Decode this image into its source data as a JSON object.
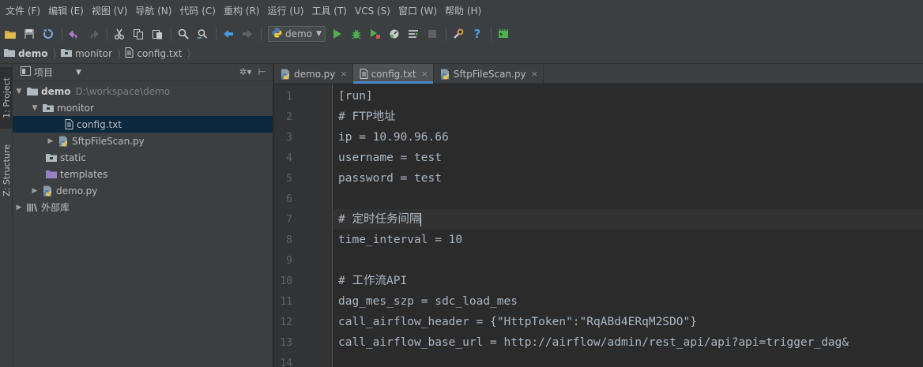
{
  "menubar": {
    "items": [
      "文件 (F)",
      "编辑 (E)",
      "视图 (V)",
      "导航 (N)",
      "代码 (C)",
      "重构 (R)",
      "运行 (U)",
      "工具 (T)",
      "VCS (S)",
      "窗口 (W)",
      "帮助 (H)"
    ]
  },
  "toolbar": {
    "run_config": "demo"
  },
  "breadcrumb": {
    "items": [
      "demo",
      "monitor",
      "config.txt"
    ]
  },
  "stripe": {
    "project_tab": "1: Project",
    "structure_tab": "Z: Structure"
  },
  "project_panel": {
    "title": "项目",
    "tree": [
      {
        "label": "demo",
        "path": "D:\\workspace\\demo"
      },
      {
        "label": "monitor"
      },
      {
        "label": "config.txt"
      },
      {
        "label": "SftpFileScan.py"
      },
      {
        "label": "static"
      },
      {
        "label": "templates"
      },
      {
        "label": "demo.py"
      },
      {
        "label": "外部库"
      }
    ]
  },
  "editor": {
    "tabs": [
      "demo.py",
      "config.txt",
      "SftpFileScan.py"
    ],
    "active_tab": "config.txt",
    "line_numbers": [
      "1",
      "2",
      "3",
      "4",
      "5",
      "6",
      "7",
      "8",
      "9",
      "10",
      "11",
      "12",
      "13",
      "14"
    ],
    "lines": [
      "[run]",
      "# FTP地址",
      "ip = 10.90.96.66",
      "username = test",
      "password = test",
      "",
      "# 定时任务间隔",
      "time_interval = 10",
      "",
      "# 工作流API",
      "dag_mes_szp = sdc_load_mes",
      "call_airflow_header = {\"HttpToken\":\"RqABd4ERqM2SDO\"}",
      "call_airflow_base_url = http://airflow/admin/rest_api/api?api=trigger_dag&",
      ""
    ],
    "current_line": 7
  },
  "colors": {
    "background": "#2b2b2b",
    "panel": "#3c3f41",
    "selection": "#0d293e",
    "text": "#a9b7c6"
  }
}
